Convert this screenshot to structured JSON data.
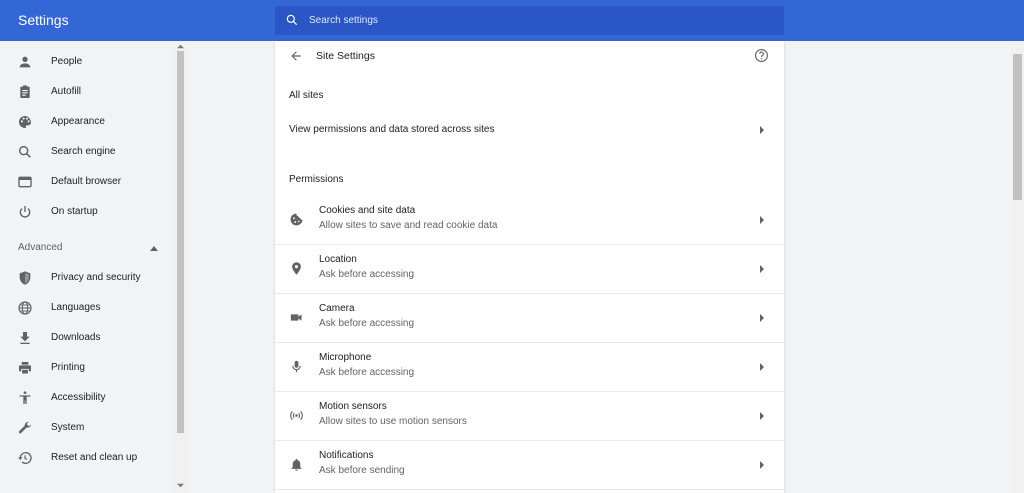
{
  "header": {
    "title": "Settings",
    "search_placeholder": "Search settings"
  },
  "sidebar": {
    "items": [
      {
        "label": "People",
        "icon": "person-icon"
      },
      {
        "label": "Autofill",
        "icon": "clipboard-icon"
      },
      {
        "label": "Appearance",
        "icon": "palette-icon"
      },
      {
        "label": "Search engine",
        "icon": "search-icon"
      },
      {
        "label": "Default browser",
        "icon": "browser-icon"
      },
      {
        "label": "On startup",
        "icon": "power-icon"
      }
    ],
    "advanced_label": "Advanced",
    "advanced_items": [
      {
        "label": "Privacy and security",
        "icon": "shield-icon"
      },
      {
        "label": "Languages",
        "icon": "globe-icon"
      },
      {
        "label": "Downloads",
        "icon": "download-icon"
      },
      {
        "label": "Printing",
        "icon": "printer-icon"
      },
      {
        "label": "Accessibility",
        "icon": "accessibility-icon"
      },
      {
        "label": "System",
        "icon": "wrench-icon"
      },
      {
        "label": "Reset and clean up",
        "icon": "restore-icon"
      }
    ]
  },
  "main": {
    "title": "Site Settings",
    "all_sites_heading": "All sites",
    "all_sites_link": "View permissions and data stored across sites",
    "permissions_heading": "Permissions",
    "permissions": [
      {
        "name": "Cookies and site data",
        "desc": "Allow sites to save and read cookie data",
        "icon": "cookie-icon"
      },
      {
        "name": "Location",
        "desc": "Ask before accessing",
        "icon": "location-icon"
      },
      {
        "name": "Camera",
        "desc": "Ask before accessing",
        "icon": "camera-icon"
      },
      {
        "name": "Microphone",
        "desc": "Ask before accessing",
        "icon": "microphone-icon"
      },
      {
        "name": "Motion sensors",
        "desc": "Allow sites to use motion sensors",
        "icon": "sensors-icon"
      },
      {
        "name": "Notifications",
        "desc": "Ask before sending",
        "icon": "bell-icon"
      }
    ]
  },
  "colors": {
    "header": "#3367d6",
    "search_bg": "#2a56c6",
    "icon": "#5f6368",
    "page_bg": "#f1f3f4"
  }
}
